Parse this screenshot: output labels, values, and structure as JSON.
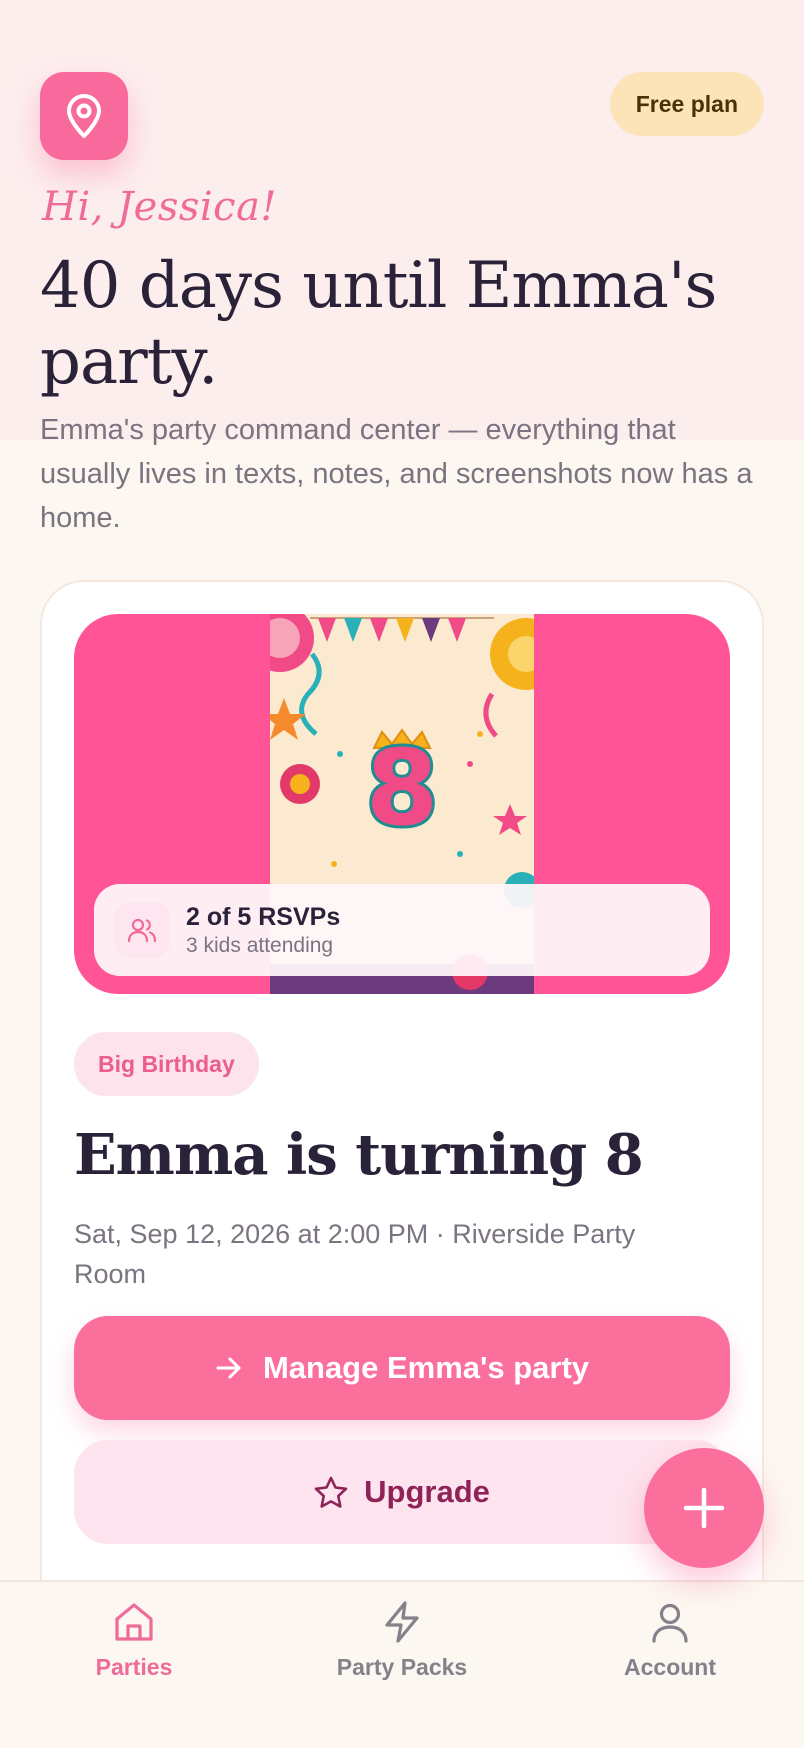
{
  "header": {
    "logo_icon": "map-pin-icon",
    "plan_badge": "Free plan",
    "greeting": "Hi, Jessica!",
    "headline": "40 days until Emma's party.",
    "subtitle": "Emma's party command center — everything that usually lives in texts, notes, and screenshots now has a home."
  },
  "party_card": {
    "rsvp": {
      "icon": "users-icon",
      "title": "2 of 5 RSVPs",
      "subtitle": "3 kids attending"
    },
    "tag": "Big Birthday",
    "title": "Emma is turning 8",
    "meta": "Sat, Sep 12, 2026 at 2:00 PM · Riverside Party Room",
    "invite_number": "8",
    "manage_button": "Manage Emma's party",
    "upgrade_button": "Upgrade"
  },
  "fab": {
    "icon": "plus-icon"
  },
  "tabs": [
    {
      "label": "Parties",
      "icon": "home-icon",
      "active": true
    },
    {
      "label": "Party Packs",
      "icon": "lightning-icon",
      "active": false
    },
    {
      "label": "Account",
      "icon": "user-icon",
      "active": false
    }
  ],
  "colors": {
    "accent": "#fb6f9c",
    "hero_background": "#ff5596",
    "plan_badge": "#fde4b8",
    "page_background": "#fdf7f1",
    "heading_text": "#2a2238"
  }
}
